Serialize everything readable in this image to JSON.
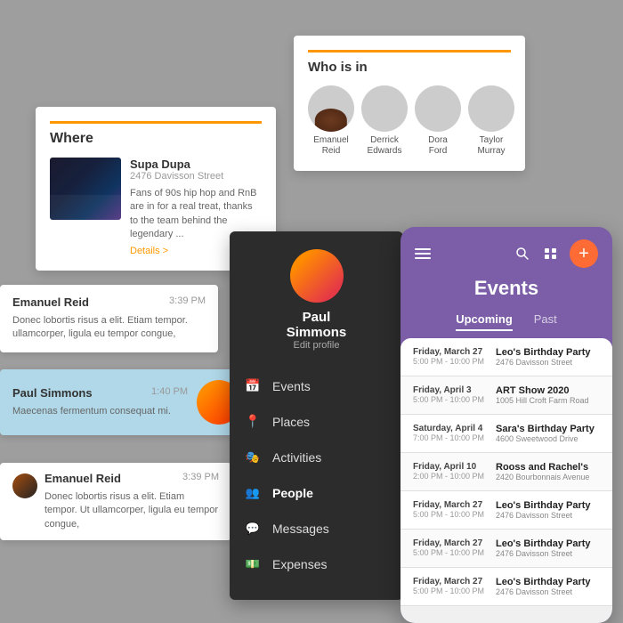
{
  "where_card": {
    "title": "Where",
    "venue_name": "Supa Dupa",
    "venue_address": "2476  Davisson Street",
    "venue_desc": "Fans of 90s hip hop and RnB are in for a real treat, thanks to the team behind the legendary ...",
    "details_link": "Details >"
  },
  "who_card": {
    "title": "Who is in",
    "people": [
      {
        "name": "Emanuel\nReid",
        "avatar_class": "face-eman"
      },
      {
        "name": "Derrick\nEdwards",
        "avatar_class": "face-derrick"
      },
      {
        "name": "Dora\nFord",
        "avatar_class": "face-dora"
      },
      {
        "name": "Taylor\nMurray",
        "avatar_class": "face-taylor"
      }
    ]
  },
  "chat": {
    "messages": [
      {
        "id": 1,
        "name": "Emanuel Reid",
        "time": "3:39 PM",
        "text": "Donec lobortis risus a elit. Etiam tempor. ullamcorper, ligula eu tempor congue,"
      },
      {
        "id": 2,
        "name": "Paul Simmons",
        "time": "1:40 PM",
        "text": "Maecenas fermentum consequat mi."
      },
      {
        "id": 3,
        "name": "Emanuel Reid",
        "time": "3:39 PM",
        "text": "Donec lobortis risus a elit. Etiam tempor. Ut ullamcorper, ligula eu tempor congue,"
      }
    ]
  },
  "sidebar": {
    "user_name": "Paul\nSimmons",
    "edit_label": "Edit profile",
    "items": [
      {
        "id": "events",
        "label": "Events",
        "icon": "calendar"
      },
      {
        "id": "places",
        "label": "Places",
        "icon": "pin"
      },
      {
        "id": "activities",
        "label": "Activities",
        "icon": "activities"
      },
      {
        "id": "people",
        "label": "People",
        "icon": "people",
        "active": true
      },
      {
        "id": "messages",
        "label": "Messages",
        "icon": "messages"
      },
      {
        "id": "expenses",
        "label": "Expenses",
        "icon": "expenses"
      }
    ]
  },
  "events_app": {
    "title": "Events",
    "tabs": [
      "Upcoming",
      "Past"
    ],
    "active_tab": "Upcoming",
    "hamburger_label": "menu",
    "search_label": "search",
    "grid_label": "grid-view",
    "add_label": "add",
    "events": [
      {
        "date": "Friday, March 27",
        "time": "5:00 PM - 10:00 PM",
        "name": "Leo's Birthday Party",
        "location": "2476  Davisson Street"
      },
      {
        "date": "Friday, April 3",
        "time": "5:00 PM - 10:00 PM",
        "name": "ART Show 2020",
        "location": "1005  Hill Croft Farm Road"
      },
      {
        "date": "Saturday, April 4",
        "time": "7:00 PM - 10:00 PM",
        "name": "Sara's Birthday Party",
        "location": "4600  Sweetwood Drive"
      },
      {
        "date": "Friday, April 10",
        "time": "2:00 PM - 10:00 PM",
        "name": "Rooss and Rachel's",
        "location": "2420  Bourbonnais Avenue"
      },
      {
        "date": "Friday, March 27",
        "time": "5:00 PM - 10:00 PM",
        "name": "Leo's Birthday Party",
        "location": "2476  Davisson Street"
      },
      {
        "date": "Friday, March 27",
        "time": "5:00 PM - 10:00 PM",
        "name": "Leo's Birthday Party",
        "location": "2476  Davisson Street"
      },
      {
        "date": "Friday, March 27",
        "time": "5:00 PM - 10:00 PM",
        "name": "Leo's Birthday Party",
        "location": "2476  Davisson Street"
      }
    ]
  }
}
